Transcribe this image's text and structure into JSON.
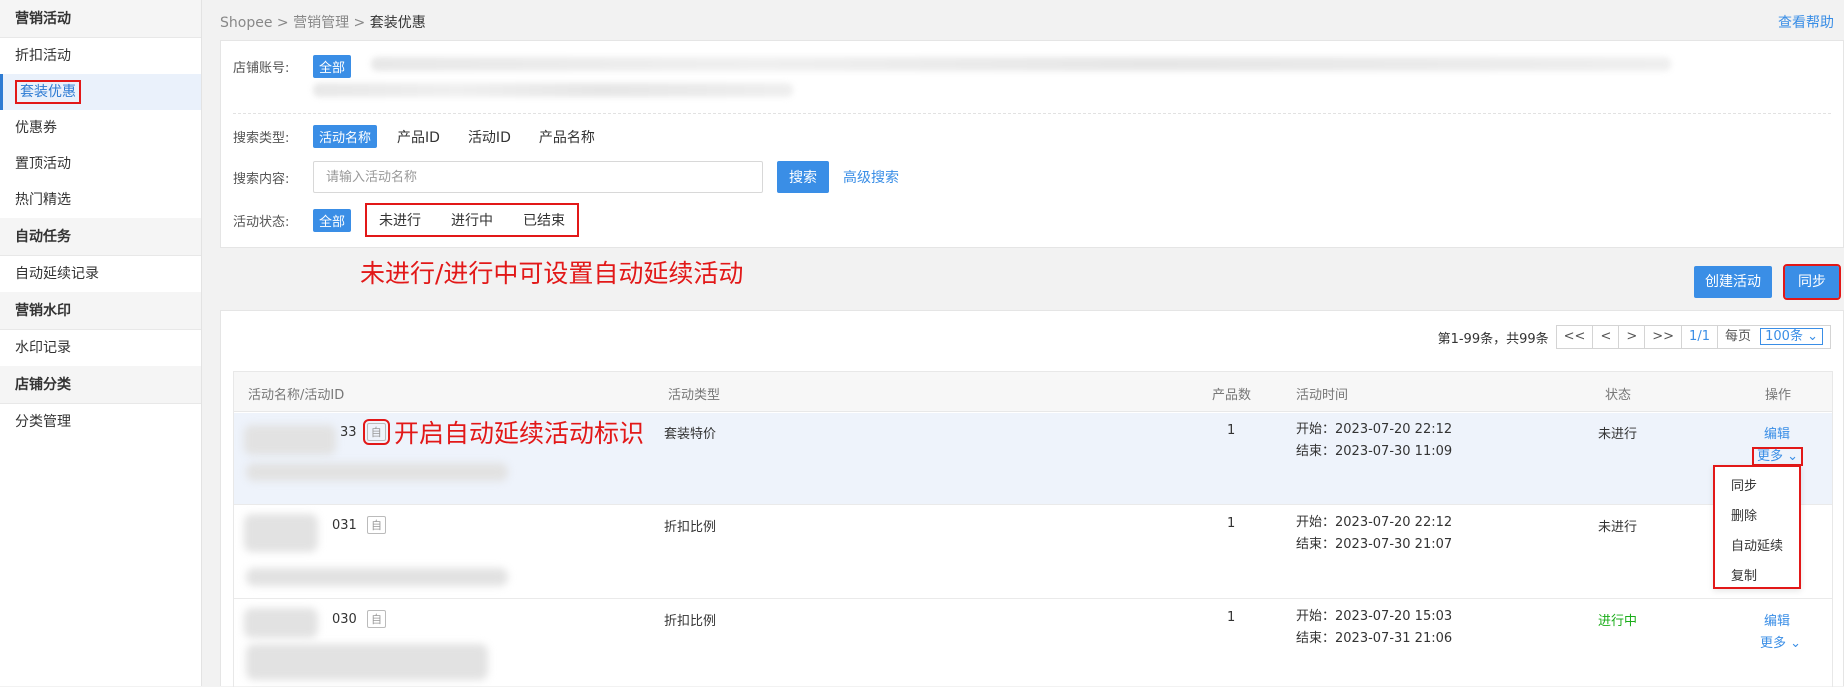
{
  "sidebar": {
    "groups": [
      {
        "title": "营销活动",
        "items": [
          "折扣活动",
          "套装优惠",
          "优惠券",
          "置顶活动",
          "热门精选"
        ]
      },
      {
        "title": "自动任务",
        "items": [
          "自动延续记录"
        ]
      },
      {
        "title": "营销水印",
        "items": [
          "水印记录"
        ]
      },
      {
        "title": "店铺分类",
        "items": [
          "分类管理"
        ]
      }
    ]
  },
  "breadcrumb": {
    "root": "Shopee",
    "sep": ">",
    "level2": "营销管理",
    "current": "套装优惠"
  },
  "help": "查看帮助",
  "filters": {
    "account_label": "店铺账号:",
    "account_all": "全部",
    "type_label": "搜索类型:",
    "type_options": [
      "活动名称",
      "产品ID",
      "活动ID",
      "产品名称"
    ],
    "content_label": "搜索内容:",
    "search_placeholder": "请输入活动名称",
    "search_button": "搜索",
    "advanced": "高级搜索",
    "status_label": "活动状态:",
    "status_all": "全部",
    "status_options": [
      "未进行",
      "进行中",
      "已结束"
    ]
  },
  "annotations": {
    "status_note": "未进行/进行中可设置自动延续活动",
    "tag_note": "开启自动延续活动标识"
  },
  "actions": {
    "create": "创建活动",
    "sync": "同步"
  },
  "pager": {
    "summary": "第1-99条，共99条",
    "first": "<<",
    "prev": "<",
    "next": ">",
    "last": ">>",
    "page": "1/1",
    "per_page_label": "每页",
    "per_page": "100条"
  },
  "table": {
    "headers": [
      "活动名称/活动ID",
      "活动类型",
      "产品数",
      "活动时间",
      "状态",
      "操作"
    ],
    "rows": [
      {
        "id_suffix": "33",
        "type": "套装特价",
        "count": "1",
        "start": "开始：2023-07-20 22:12",
        "end": "结束：2023-07-30 11:09",
        "status": "未进行",
        "edit": "编辑",
        "more": "更多"
      },
      {
        "id_suffix": "031",
        "type": "折扣比例",
        "count": "1",
        "start": "开始：2023-07-20 22:12",
        "end": "结束：2023-07-30 21:07",
        "status": "未进行",
        "edit": "",
        "more": ""
      },
      {
        "id_suffix": "030",
        "type": "折扣比例",
        "count": "1",
        "start": "开始：2023-07-20 15:03",
        "end": "结束：2023-07-31 21:06",
        "status": "进行中",
        "edit": "编辑",
        "more": "更多"
      }
    ],
    "auto_tag": "自"
  },
  "dropdown": {
    "items": [
      "同步",
      "删除",
      "自动延续",
      "复制"
    ]
  }
}
